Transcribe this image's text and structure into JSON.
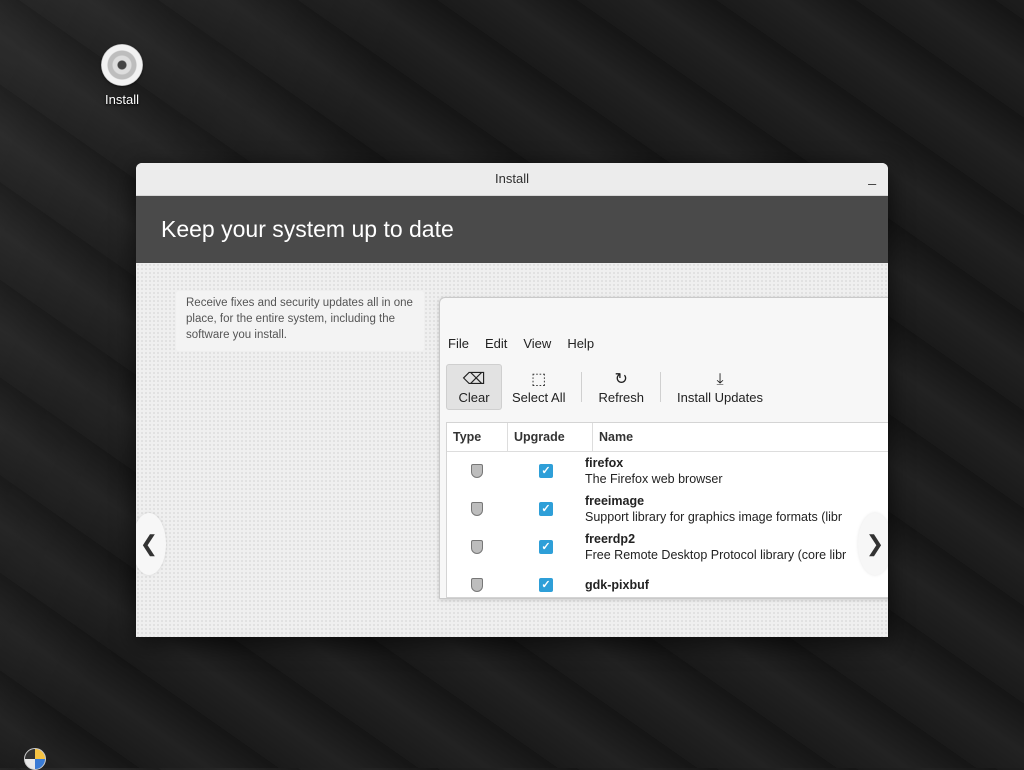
{
  "desktop": {
    "icon_label": "Install"
  },
  "window": {
    "title": "Install",
    "minimize_glyph": "_",
    "banner_title": "Keep your system up to date",
    "description": "Receive fixes and security updates all in one place, for the entire system, including the software you install.",
    "nav_prev": "❮",
    "nav_next": "❯"
  },
  "screenshot": {
    "menu": [
      "File",
      "Edit",
      "View",
      "Help"
    ],
    "toolbar": [
      {
        "label": "Clear",
        "icon": "⌫"
      },
      {
        "label": "Select All",
        "icon": "⬚"
      },
      {
        "label": "Refresh",
        "icon": "↻"
      },
      {
        "label": "Install Updates",
        "icon": "⤓"
      }
    ],
    "columns": [
      "Type",
      "Upgrade",
      "Name"
    ],
    "rows": [
      {
        "name": "firefox",
        "desc": "The Firefox web browser"
      },
      {
        "name": "freeimage",
        "desc": "Support library for graphics image formats (libr"
      },
      {
        "name": "freerdp2",
        "desc": "Free Remote Desktop Protocol library (core libr"
      },
      {
        "name": "gdk-pixbuf",
        "desc": ""
      }
    ]
  }
}
